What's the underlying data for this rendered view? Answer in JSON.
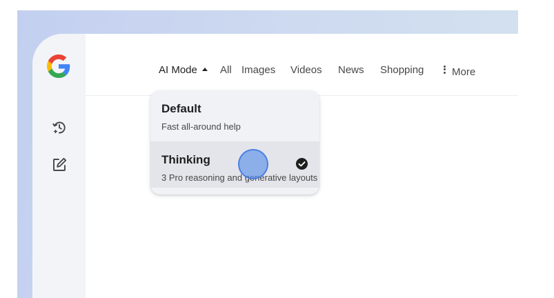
{
  "brand": {
    "logo_icon": "google-g-logo",
    "colors": {
      "blue": "#4285F4",
      "red": "#EA4335",
      "yellow": "#FBBC05",
      "green": "#34A853"
    }
  },
  "sidebar": {
    "items": [
      {
        "icon": "history-icon"
      },
      {
        "icon": "new-chat-icon"
      }
    ]
  },
  "nav": {
    "tabs": [
      {
        "label": "AI Mode",
        "active": true
      },
      {
        "label": "All"
      },
      {
        "label": "Images"
      },
      {
        "label": "Videos"
      },
      {
        "label": "News"
      },
      {
        "label": "Shopping"
      },
      {
        "label": "More",
        "icon": "more-vert-icon"
      }
    ]
  },
  "mode_menu": {
    "options": [
      {
        "title": "Default",
        "description": "Fast all-around help",
        "selected": false
      },
      {
        "title": "Thinking",
        "description": "3 Pro reasoning and generative layouts",
        "selected": true,
        "icon": "check-circle-icon"
      }
    ]
  }
}
